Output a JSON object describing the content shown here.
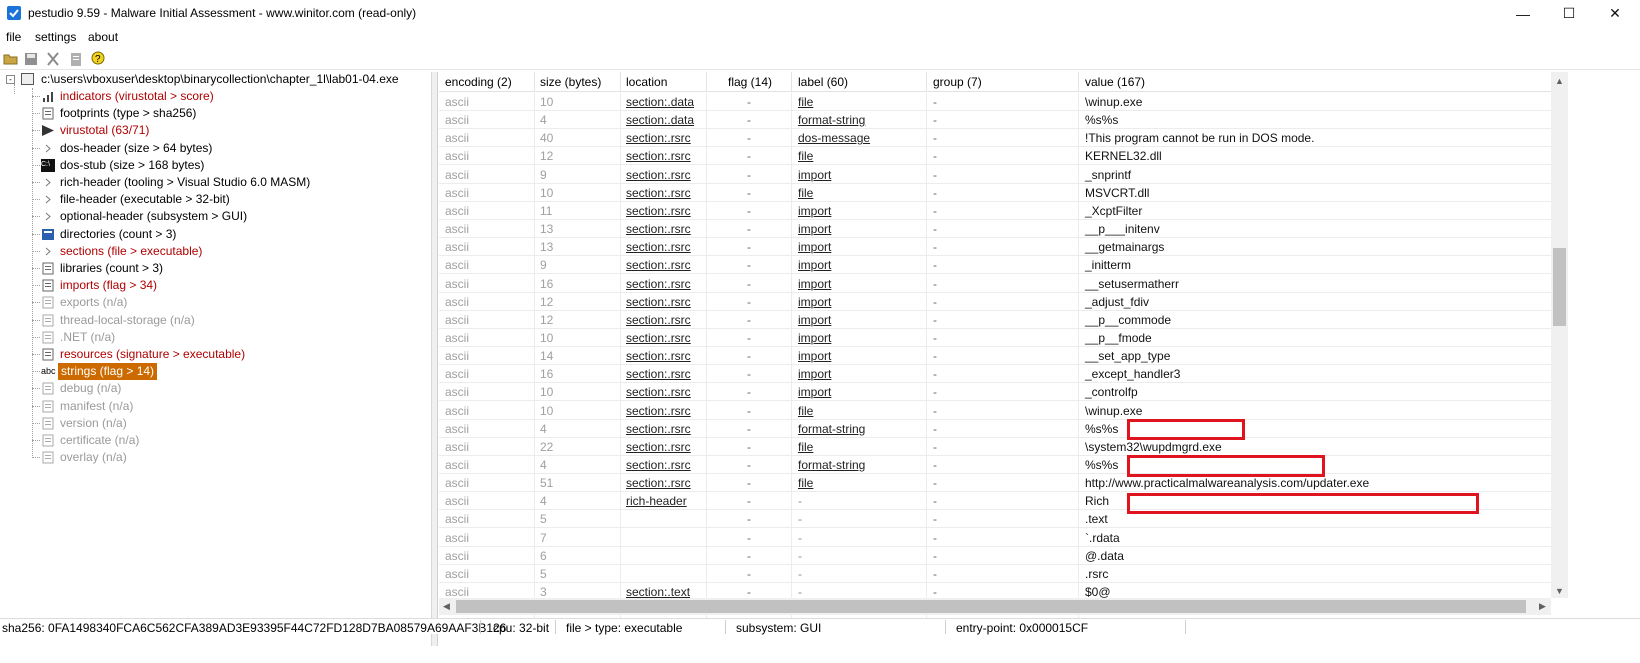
{
  "window": {
    "title": "pestudio 9.59 - Malware Initial Assessment - www.winitor.com (read-only)",
    "minimize": "—",
    "maximize": "☐",
    "close": "✕"
  },
  "menu": {
    "file": "file",
    "settings": "settings",
    "about": "about"
  },
  "tree": {
    "root": "c:\\users\\vboxuser\\desktop\\binarycollection\\chapter_1l\\lab01-04.exe",
    "items": [
      {
        "label": "indicators (virustotal > score)",
        "style": "red",
        "icon": "indicators-icon"
      },
      {
        "label": "footprints (type > sha256)",
        "style": "normal",
        "icon": "footprints-icon"
      },
      {
        "label": "virustotal (63/71)",
        "style": "red",
        "icon": "virustotal-icon"
      },
      {
        "label": "dos-header (size > 64 bytes)",
        "style": "normal",
        "icon": "expand-icon"
      },
      {
        "label": "dos-stub (size > 168 bytes)",
        "style": "normal",
        "icon": "dos-stub-icon"
      },
      {
        "label": "rich-header (tooling > Visual Studio 6.0 MASM)",
        "style": "normal",
        "icon": "expand-icon"
      },
      {
        "label": "file-header (executable > 32-bit)",
        "style": "normal",
        "icon": "expand-icon"
      },
      {
        "label": "optional-header (subsystem > GUI)",
        "style": "normal",
        "icon": "expand-icon"
      },
      {
        "label": "directories (count > 3)",
        "style": "normal",
        "icon": "directories-icon"
      },
      {
        "label": "sections (file > executable)",
        "style": "red",
        "icon": "expand-icon"
      },
      {
        "label": "libraries (count > 3)",
        "style": "normal",
        "icon": "libraries-icon"
      },
      {
        "label": "imports (flag > 34)",
        "style": "red",
        "icon": "imports-icon"
      },
      {
        "label": "exports (n/a)",
        "style": "gray",
        "icon": "exports-icon"
      },
      {
        "label": "thread-local-storage (n/a)",
        "style": "gray",
        "icon": "tls-icon"
      },
      {
        "label": ".NET (n/a)",
        "style": "gray",
        "icon": "dotnet-icon"
      },
      {
        "label": "resources (signature > executable)",
        "style": "red",
        "icon": "resources-icon"
      },
      {
        "label": "strings (flag > 14)",
        "style": "selected",
        "icon": "strings-icon"
      },
      {
        "label": "debug (n/a)",
        "style": "gray",
        "icon": "debug-icon"
      },
      {
        "label": "manifest (n/a)",
        "style": "gray",
        "icon": "manifest-icon"
      },
      {
        "label": "version (n/a)",
        "style": "gray",
        "icon": "version-icon"
      },
      {
        "label": "certificate (n/a)",
        "style": "gray",
        "icon": "certificate-icon"
      },
      {
        "label": "overlay (n/a)",
        "style": "gray",
        "icon": "overlay-icon"
      }
    ],
    "strings_icon_text": "abc",
    "dos_stub_icon_text": "C:\\"
  },
  "grid": {
    "columns": {
      "encoding": "encoding (2)",
      "size": "size (bytes)",
      "location": "location",
      "flag": "flag (14)",
      "label": "label (60)",
      "group": "group (7)",
      "value": "value (167)"
    },
    "rows": [
      {
        "encoding": "ascii",
        "size": "10",
        "location": "section:.data",
        "flag": "-",
        "label": "file",
        "group": "-",
        "value": "\\winup.exe"
      },
      {
        "encoding": "ascii",
        "size": "4",
        "location": "section:.data",
        "flag": "-",
        "label": "format-string",
        "group": "-",
        "value": "%s%s"
      },
      {
        "encoding": "ascii",
        "size": "40",
        "location": "section:.rsrc",
        "flag": "-",
        "label": "dos-message",
        "group": "-",
        "value": "!This program cannot be run in DOS mode."
      },
      {
        "encoding": "ascii",
        "size": "12",
        "location": "section:.rsrc",
        "flag": "-",
        "label": "file",
        "group": "-",
        "value": "KERNEL32.dll"
      },
      {
        "encoding": "ascii",
        "size": "9",
        "location": "section:.rsrc",
        "flag": "-",
        "label": "import",
        "group": "-",
        "value": "_snprintf"
      },
      {
        "encoding": "ascii",
        "size": "10",
        "location": "section:.rsrc",
        "flag": "-",
        "label": "file",
        "group": "-",
        "value": "MSVCRT.dll"
      },
      {
        "encoding": "ascii",
        "size": "11",
        "location": "section:.rsrc",
        "flag": "-",
        "label": "import",
        "group": "-",
        "value": "_XcptFilter"
      },
      {
        "encoding": "ascii",
        "size": "13",
        "location": "section:.rsrc",
        "flag": "-",
        "label": "import",
        "group": "-",
        "value": "__p___initenv"
      },
      {
        "encoding": "ascii",
        "size": "13",
        "location": "section:.rsrc",
        "flag": "-",
        "label": "import",
        "group": "-",
        "value": "__getmainargs"
      },
      {
        "encoding": "ascii",
        "size": "9",
        "location": "section:.rsrc",
        "flag": "-",
        "label": "import",
        "group": "-",
        "value": "_initterm"
      },
      {
        "encoding": "ascii",
        "size": "16",
        "location": "section:.rsrc",
        "flag": "-",
        "label": "import",
        "group": "-",
        "value": "__setusermatherr"
      },
      {
        "encoding": "ascii",
        "size": "12",
        "location": "section:.rsrc",
        "flag": "-",
        "label": "import",
        "group": "-",
        "value": "_adjust_fdiv"
      },
      {
        "encoding": "ascii",
        "size": "12",
        "location": "section:.rsrc",
        "flag": "-",
        "label": "import",
        "group": "-",
        "value": "__p__commode"
      },
      {
        "encoding": "ascii",
        "size": "10",
        "location": "section:.rsrc",
        "flag": "-",
        "label": "import",
        "group": "-",
        "value": "__p__fmode"
      },
      {
        "encoding": "ascii",
        "size": "14",
        "location": "section:.rsrc",
        "flag": "-",
        "label": "import",
        "group": "-",
        "value": "__set_app_type"
      },
      {
        "encoding": "ascii",
        "size": "16",
        "location": "section:.rsrc",
        "flag": "-",
        "label": "import",
        "group": "-",
        "value": "_except_handler3"
      },
      {
        "encoding": "ascii",
        "size": "10",
        "location": "section:.rsrc",
        "flag": "-",
        "label": "import",
        "group": "-",
        "value": "_controlfp"
      },
      {
        "encoding": "ascii",
        "size": "10",
        "location": "section:.rsrc",
        "flag": "-",
        "label": "file",
        "group": "-",
        "value": "\\winup.exe"
      },
      {
        "encoding": "ascii",
        "size": "4",
        "location": "section:.rsrc",
        "flag": "-",
        "label": "format-string",
        "group": "-",
        "value": "%s%s"
      },
      {
        "encoding": "ascii",
        "size": "22",
        "location": "section:.rsrc",
        "flag": "-",
        "label": "file",
        "group": "-",
        "value": "\\system32\\wupdmgrd.exe"
      },
      {
        "encoding": "ascii",
        "size": "4",
        "location": "section:.rsrc",
        "flag": "-",
        "label": "format-string",
        "group": "-",
        "value": "%s%s"
      },
      {
        "encoding": "ascii",
        "size": "51",
        "location": "section:.rsrc",
        "flag": "-",
        "label": "file",
        "group": "-",
        "value": "http://www.practicalmalwareanalysis.com/updater.exe"
      },
      {
        "encoding": "ascii",
        "size": "4",
        "location": "rich-header",
        "flag": "-",
        "label": "-",
        "group": "-",
        "value": "Rich"
      },
      {
        "encoding": "ascii",
        "size": "5",
        "location": "",
        "flag": "-",
        "label": "-",
        "group": "-",
        "value": ".text"
      },
      {
        "encoding": "ascii",
        "size": "7",
        "location": "",
        "flag": "-",
        "label": "-",
        "group": "-",
        "value": "`.rdata"
      },
      {
        "encoding": "ascii",
        "size": "6",
        "location": "",
        "flag": "-",
        "label": "-",
        "group": "-",
        "value": "@.data"
      },
      {
        "encoding": "ascii",
        "size": "5",
        "location": "",
        "flag": "-",
        "label": "-",
        "group": "-",
        "value": ".rsrc"
      },
      {
        "encoding": "ascii",
        "size": "3",
        "location": "section:.text",
        "flag": "-",
        "label": "-",
        "group": "-",
        "value": "$0@"
      }
    ],
    "highlighted_rows": [
      17,
      19,
      21
    ],
    "highlight_color": "#e0141e"
  },
  "status": {
    "sha256": "sha256: 0FA1498340FCA6C562CFA389AD3E93395F44C72FD128D7BA08579A69AAF3B126",
    "cpu": "cpu: 32-bit",
    "file_type": "file > type: executable",
    "subsystem": "subsystem: GUI",
    "entry_point": "entry-point: 0x000015CF"
  },
  "colors": {
    "selected_bg": "#cc6a00",
    "warning_text": "#b00000",
    "muted_text": "#9a9a9a"
  }
}
